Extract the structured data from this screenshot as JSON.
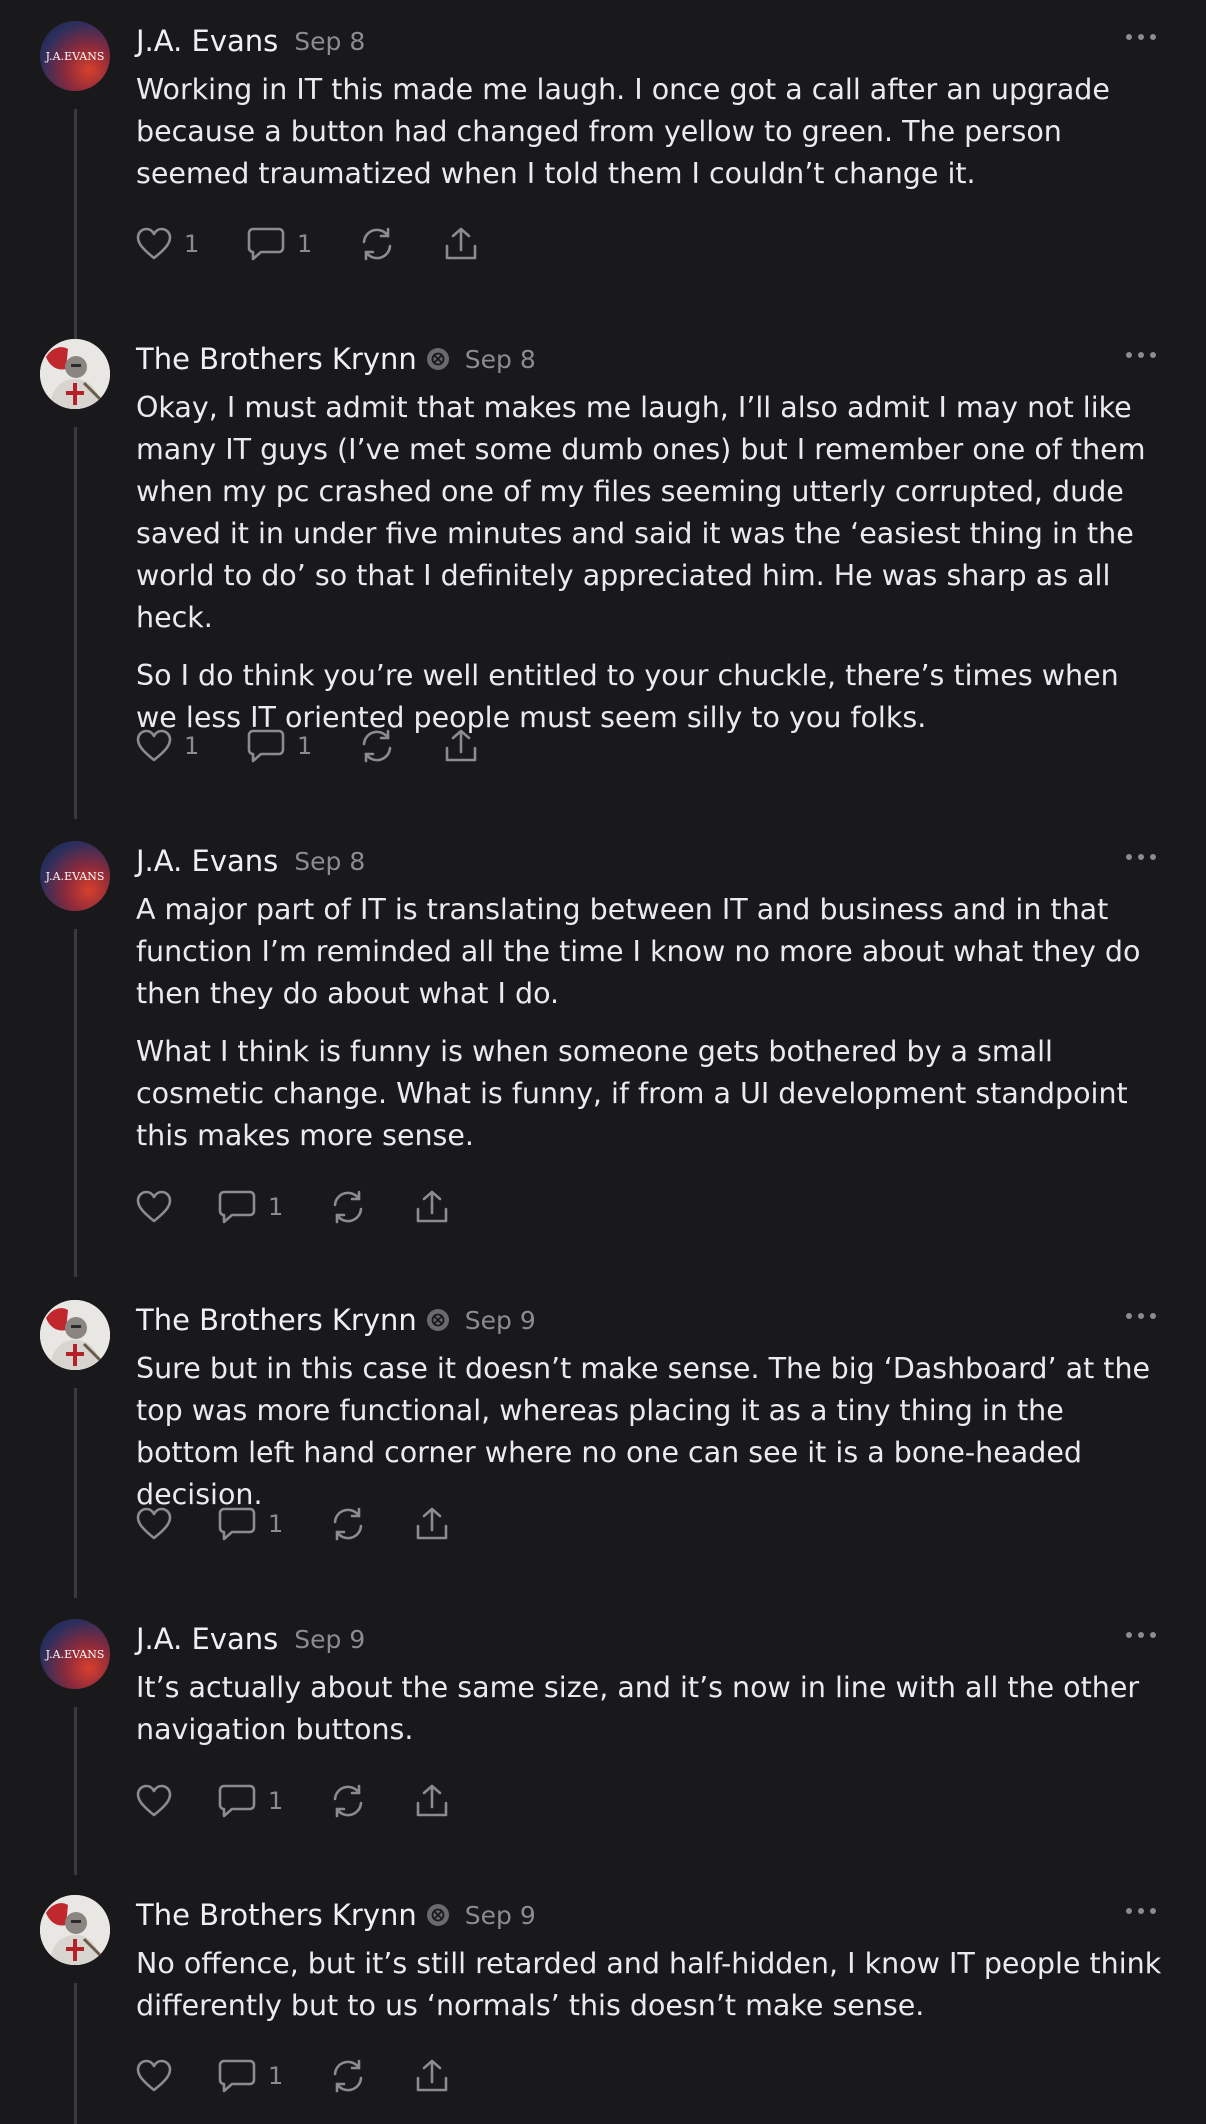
{
  "comments": [
    {
      "author": "J.A. Evans",
      "date": "Sep 8",
      "paragraphs": [
        "Working in IT this made me laugh. I once got a call after an upgrade because a button had changed from yellow to green. The person seemed traumatized when I told them I couldn’t change it."
      ],
      "likes": "1",
      "replies": "1"
    },
    {
      "author": "The Brothers Krynn",
      "date": "Sep 8",
      "paragraphs": [
        "Okay, I must admit that makes me laugh, I’ll also admit I may not like many IT guys (I’ve met some dumb ones) but I remember one of them when my pc crashed one of my files seeming utterly corrupted, dude saved it in under five minutes and said it was the ‘easiest thing in the world to do’ so that I definitely appreciated him. He was sharp as all heck.",
        "So I do think you’re well entitled to your chuckle, there’s times when we less IT oriented people must seem silly to you folks."
      ],
      "likes": "1",
      "replies": "1"
    },
    {
      "author": "J.A. Evans",
      "date": "Sep 8",
      "paragraphs": [
        "A major part of IT is translating between IT and business and in that function I’m reminded all the time I know no more about what they do then they do about what I do.",
        "What I think is funny is when someone gets bothered by a small cosmetic change. What is funny, if from a UI development standpoint this makes more sense."
      ],
      "likes": "",
      "replies": "1"
    },
    {
      "author": "The Brothers Krynn",
      "date": "Sep 9",
      "paragraphs": [
        "Sure but in this case it doesn’t make sense. The big ‘Dashboard’ at the top was more functional, whereas placing it as a tiny thing in the bottom left hand corner where no one can see it is a bone-headed decision."
      ],
      "likes": "",
      "replies": "1"
    },
    {
      "author": "J.A. Evans",
      "date": "Sep 9",
      "paragraphs": [
        "It’s actually about the same size, and it’s now in line with all the other navigation buttons."
      ],
      "likes": "",
      "replies": "1"
    },
    {
      "author": "The Brothers Krynn",
      "date": "Sep 9",
      "paragraphs": [
        "No offence, but it’s still retarded and half-hidden, I know IT people think differently but to us ‘normals’ this doesn’t make sense."
      ],
      "likes": "",
      "replies": "1"
    }
  ],
  "avatars": {
    "evans_text": "J.A.EVANS"
  },
  "colors": {
    "background": "#19191b",
    "text": "#ebebed",
    "muted": "#8b8b90",
    "thread_line": "#3a3a3d"
  }
}
